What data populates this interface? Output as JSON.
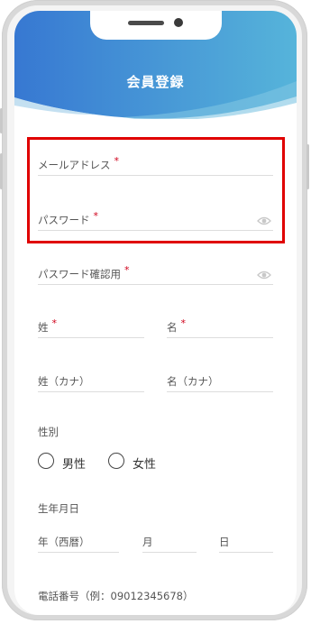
{
  "header": {
    "title": "会員登録"
  },
  "form": {
    "email": {
      "label": "メールアドレス",
      "required": "*"
    },
    "password": {
      "label": "パスワード",
      "required": "*"
    },
    "password_confirm": {
      "label": "パスワード確認用",
      "required": "*"
    },
    "last_name": {
      "label": "姓",
      "required": "*"
    },
    "first_name": {
      "label": "名",
      "required": "*"
    },
    "last_name_kana": {
      "label": "姓（カナ）"
    },
    "first_name_kana": {
      "label": "名（カナ）"
    },
    "gender": {
      "label": "性別",
      "options": [
        "男性",
        "女性"
      ]
    },
    "birthdate": {
      "label": "生年月日",
      "year": "年（西暦）",
      "month": "月",
      "day": "日"
    },
    "phone": {
      "label": "電話番号（例：09012345678）"
    }
  },
  "colors": {
    "header_start": "#3a7bd5",
    "header_end": "#4fb3d9",
    "highlight": "#e00000",
    "required": "#d0021b"
  }
}
